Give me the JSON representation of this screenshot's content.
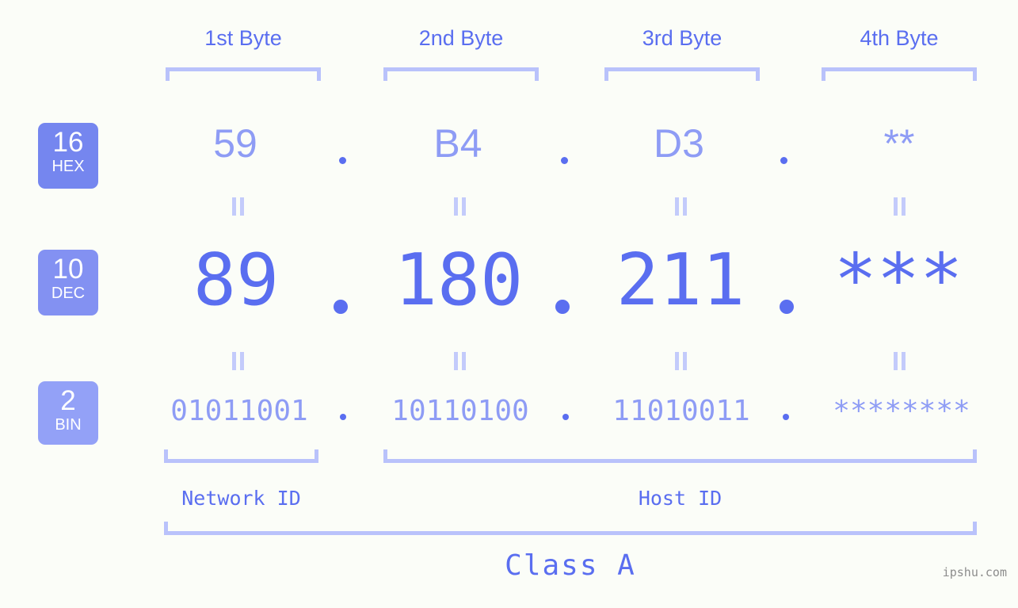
{
  "page": {
    "background_color": "#fbfdf8",
    "accent_color": "#5a6ef0",
    "accent_light_color": "#8e9cf5",
    "bracket_color": "#b9c2fb",
    "watermark": "ipshu.com"
  },
  "headers": [
    {
      "label": "1st Byte"
    },
    {
      "label": "2nd Byte"
    },
    {
      "label": "3rd Byte"
    },
    {
      "label": "4th Byte"
    }
  ],
  "bases": [
    {
      "num": "16",
      "name": "HEX",
      "color": "#7586ef"
    },
    {
      "num": "10",
      "name": "DEC",
      "color": "#8391f2"
    },
    {
      "num": "2",
      "name": "BIN",
      "color": "#93a1f7"
    }
  ],
  "rows": {
    "hex": {
      "base": "16",
      "values": [
        "59",
        "B4",
        "D3",
        "**"
      ],
      "separator": "."
    },
    "dec": {
      "base": "10",
      "values": [
        "89",
        "180",
        "211",
        "***"
      ],
      "separator": "."
    },
    "bin": {
      "base": "2",
      "values": [
        "01011001",
        "10110100",
        "11010011",
        "********"
      ],
      "separator": "."
    }
  },
  "equals": {
    "glyph": "="
  },
  "segments": {
    "network_id": "Network ID",
    "host_id": "Host ID",
    "class": "Class A"
  }
}
